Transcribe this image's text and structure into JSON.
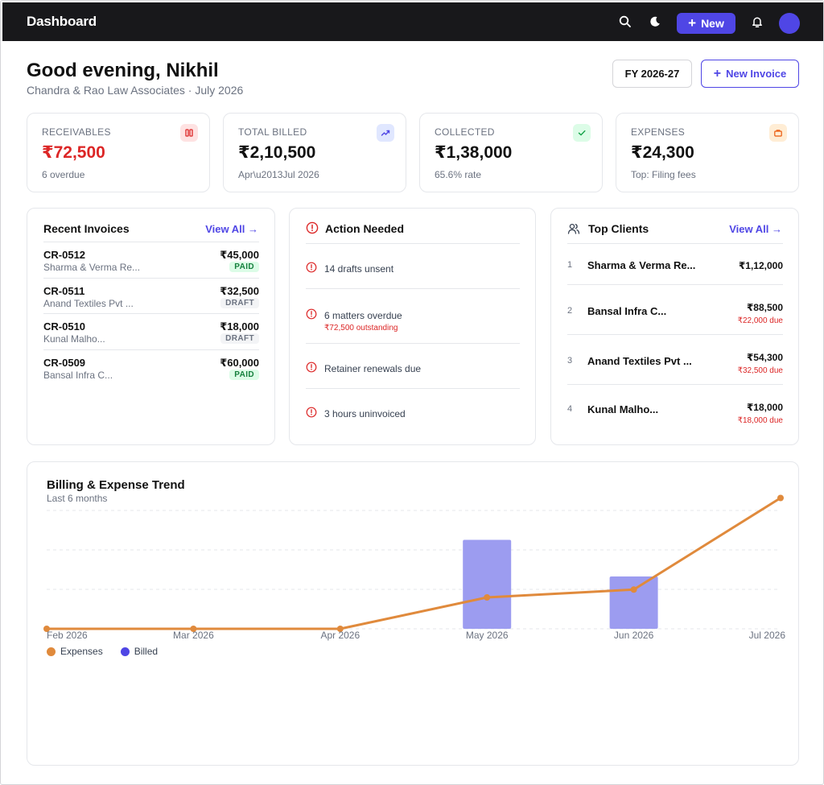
{
  "topbar": {
    "title": "Dashboard",
    "new_label": "New"
  },
  "header": {
    "greeting": "Good evening, Nikhil",
    "subline": "Chandra & Rao Law Associates · July 2026",
    "fy_label": "FY 2026-27",
    "new_invoice_label": "New Invoice"
  },
  "stats": [
    {
      "label": "RECEIVABLES",
      "value": "₹72,500",
      "sub": "6 overdue",
      "icon": "pause-icon",
      "accent": "#dc2626"
    },
    {
      "label": "TOTAL BILLED",
      "value": "₹2,10,500",
      "sub": "Apr\\u2013Jul 2026",
      "icon": "trending-up-icon",
      "accent": "#4f46e5"
    },
    {
      "label": "COLLECTED",
      "value": "₹1,38,000",
      "sub": "65.6% rate",
      "icon": "check-icon",
      "accent": "#16a34a"
    },
    {
      "label": "EXPENSES",
      "value": "₹24,300",
      "sub": "Top: Filing fees",
      "icon": "briefcase-icon",
      "accent": "#ea580c"
    }
  ],
  "recent_invoices": {
    "title": "Recent Invoices",
    "view_all": "View All →",
    "rows": [
      {
        "id": "CR-0512",
        "client": "Sharma & Verma Re...",
        "amount": "₹45,000",
        "status": "PAID"
      },
      {
        "id": "CR-0511",
        "client": "Anand Textiles Pvt ...",
        "amount": "₹32,500",
        "status": "DRAFT"
      },
      {
        "id": "CR-0510",
        "client": "Kunal Malho...",
        "amount": "₹18,000",
        "status": "DRAFT"
      },
      {
        "id": "CR-0509",
        "client": "Bansal Infra C...",
        "amount": "₹60,000",
        "status": "PAID"
      }
    ]
  },
  "action_needed": {
    "title": "Action Needed",
    "items": [
      {
        "text": "14 drafts unsent",
        "sub": ""
      },
      {
        "text": "6 matters overdue",
        "sub": "₹72,500 outstanding"
      },
      {
        "text": "Retainer renewals due",
        "sub": ""
      },
      {
        "text": "3 hours uninvoiced",
        "sub": ""
      }
    ]
  },
  "top_clients": {
    "title": "Top Clients",
    "view_all": "View All →",
    "rows": [
      {
        "rank": "1",
        "name": "Sharma & Verma Re...",
        "amount": "₹1,12,000",
        "due": ""
      },
      {
        "rank": "2",
        "name": "Bansal Infra C...",
        "amount": "₹88,500",
        "due": "₹22,000 due"
      },
      {
        "rank": "3",
        "name": "Anand Textiles Pvt ...",
        "amount": "₹54,300",
        "due": "₹32,500 due"
      },
      {
        "rank": "4",
        "name": "Kunal Malho...",
        "amount": "₹18,000",
        "due": "₹18,000 due"
      }
    ]
  },
  "colors": {
    "expenses": "#e08a3c",
    "billed": "#4f46e5",
    "billed_bar": "#9c9cf0"
  },
  "chart_data": {
    "type": "bar",
    "title": "Billing & Expense Trend",
    "subtitle": "Last 6 months",
    "categories": [
      "Feb 2026",
      "Mar 2026",
      "Apr 2026",
      "May 2026",
      "Jun 2026",
      "Jul 2026"
    ],
    "series": [
      {
        "name": "Billed",
        "type": "bar",
        "values": [
          0,
          0,
          0,
          17,
          10,
          0
        ]
      },
      {
        "name": "Expenses",
        "type": "line",
        "values": [
          0,
          0,
          0,
          6,
          7.5,
          25
        ]
      }
    ],
    "ylim": [
      0,
      30
    ],
    "grid": true,
    "legend": "bottom-left"
  }
}
